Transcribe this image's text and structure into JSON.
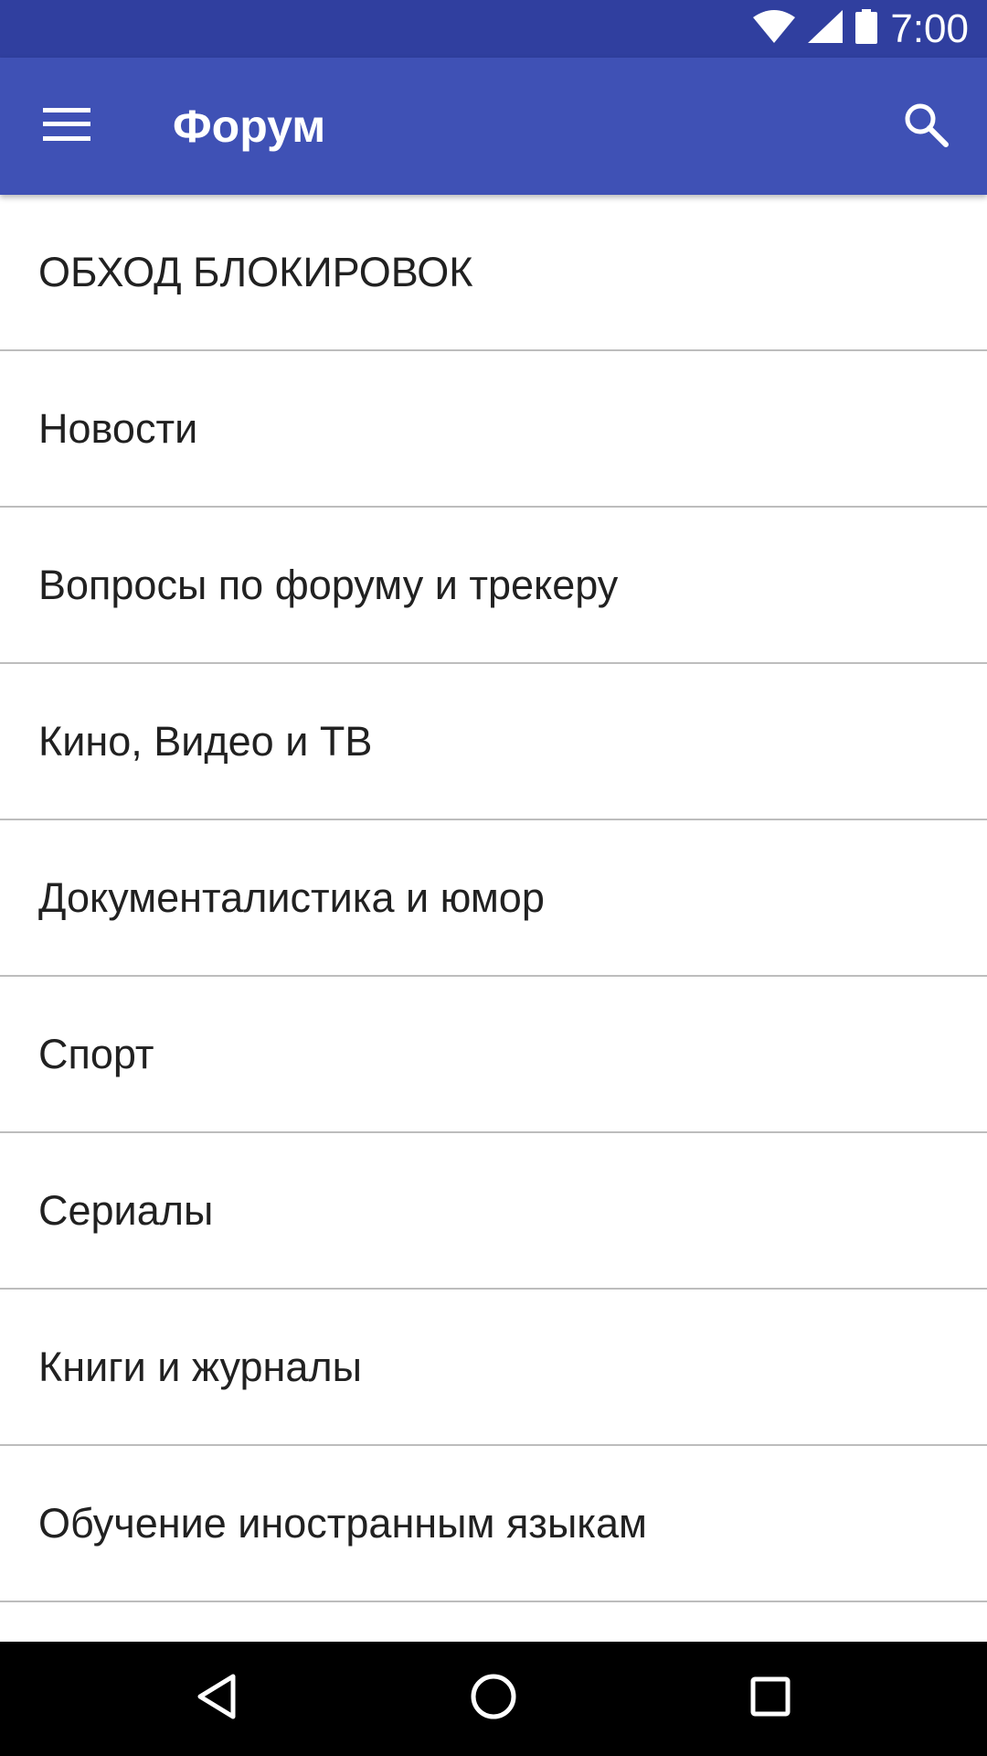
{
  "status_bar": {
    "time": "7:00",
    "icons": [
      "wifi-icon",
      "cell-signal-icon",
      "battery-icon"
    ],
    "background": "#303f9f"
  },
  "app_bar": {
    "title": "Форум",
    "menu_icon": "menu-icon",
    "search_icon": "search-icon",
    "background": "#3f51b5"
  },
  "forum_list": {
    "items": [
      {
        "label": "ОБХОД БЛОКИРОВОК"
      },
      {
        "label": "Новости"
      },
      {
        "label": "Вопросы по форуму и трекеру"
      },
      {
        "label": "Кино, Видео и ТВ"
      },
      {
        "label": "Документалистика и юмор"
      },
      {
        "label": "Спорт"
      },
      {
        "label": "Сериалы"
      },
      {
        "label": "Книги и журналы"
      },
      {
        "label": "Обучение иностранным языкам"
      },
      {
        "label": ""
      }
    ]
  },
  "nav_bar": {
    "icons": [
      "back-icon",
      "home-icon",
      "recents-icon"
    ]
  }
}
